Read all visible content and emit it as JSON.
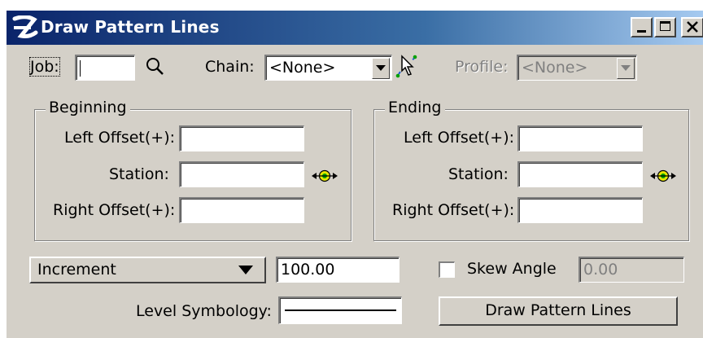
{
  "window": {
    "title": "Draw Pattern Lines",
    "controls": [
      "minimize-icon",
      "maximize-icon",
      "close-icon"
    ]
  },
  "top_row": {
    "job_label": "Job:",
    "job_value": "",
    "chain_label": "Chain:",
    "chain_value": "<None>",
    "profile_label": "Profile:",
    "profile_value": "<None>"
  },
  "beginning": {
    "title": "Beginning",
    "left_offset_label": "Left Offset(+):",
    "station_label": "Station:",
    "right_offset_label": "Right Offset(+):",
    "left_offset_value": "",
    "station_value": "",
    "right_offset_value": ""
  },
  "ending": {
    "title": "Ending",
    "left_offset_label": "Left Offset(+):",
    "station_label": "Station:",
    "right_offset_label": "Right Offset(+):",
    "left_offset_value": "",
    "station_value": "",
    "right_offset_value": ""
  },
  "bottom": {
    "mode_value": "Increment",
    "increment_value": "100.00",
    "skew_label": "Skew Angle",
    "skew_checked": false,
    "skew_value": "0.00",
    "level_label": "Level Symbology:",
    "draw_button": "Draw Pattern Lines"
  },
  "colors": {
    "title_start": "#0a246a",
    "title_end": "#a6caf0",
    "face": "#d4d0c8",
    "target_yellow": "#e8e800",
    "target_green": "#00a000"
  }
}
